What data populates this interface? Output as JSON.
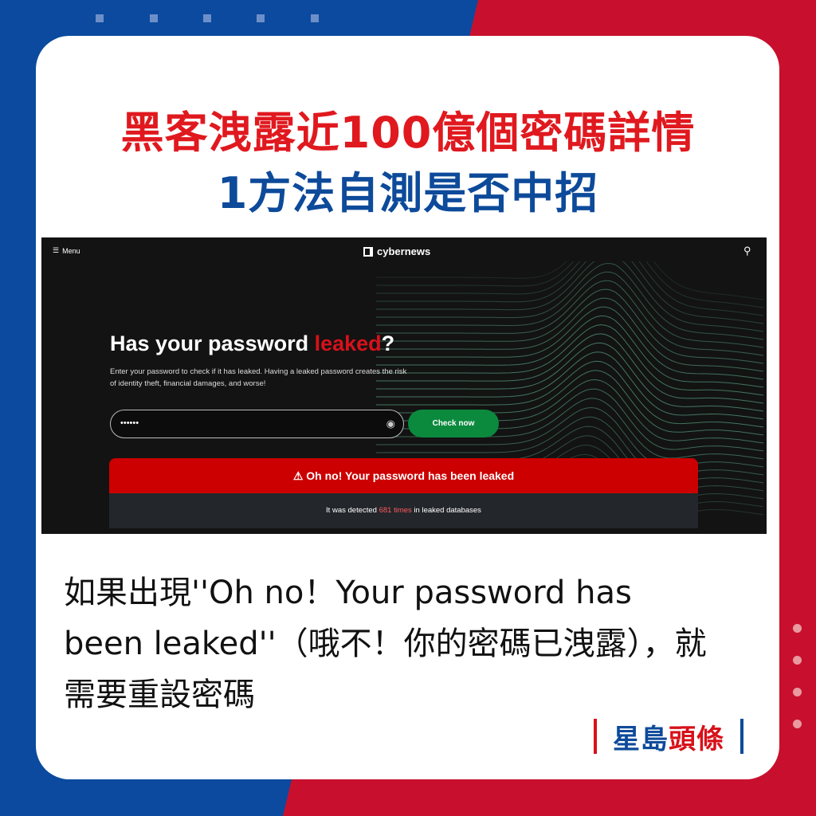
{
  "colors": {
    "blue": "#0b4a9e",
    "red": "#c8102e",
    "title_red": "#e0191f",
    "title_blue": "#0d4a9a",
    "check_green": "#0b8a3e",
    "alert_red": "#cc0000"
  },
  "title": {
    "line1": "黑客洩露近100億個密碼詳情",
    "line2": "1方法自測是否中招"
  },
  "screenshot": {
    "menu_label": "Menu",
    "menu_icon": "hamburger-icon",
    "logo": "cybernews",
    "search_icon": "search-icon",
    "headline_pre": "Has your password ",
    "headline_red": "leaked",
    "headline_post": "?",
    "subtext": "Enter your password to check if it has leaked. Having a leaked password creates the risk of identity theft, financial damages, and worse!",
    "password_value": "••••••",
    "eye_icon": "eye-icon",
    "check_button": "Check now",
    "alert": "⚠ Oh no! Your password has been leaked",
    "detected_pre": "It was detected ",
    "detected_count": "681 times",
    "detected_post": " in leaked databases"
  },
  "caption": "如果出現''Oh no！Your password has been leaked''（哦不！你的密碼已洩露），就需要重設密碼",
  "brand": {
    "blue": "星島",
    "red": "頭條"
  }
}
